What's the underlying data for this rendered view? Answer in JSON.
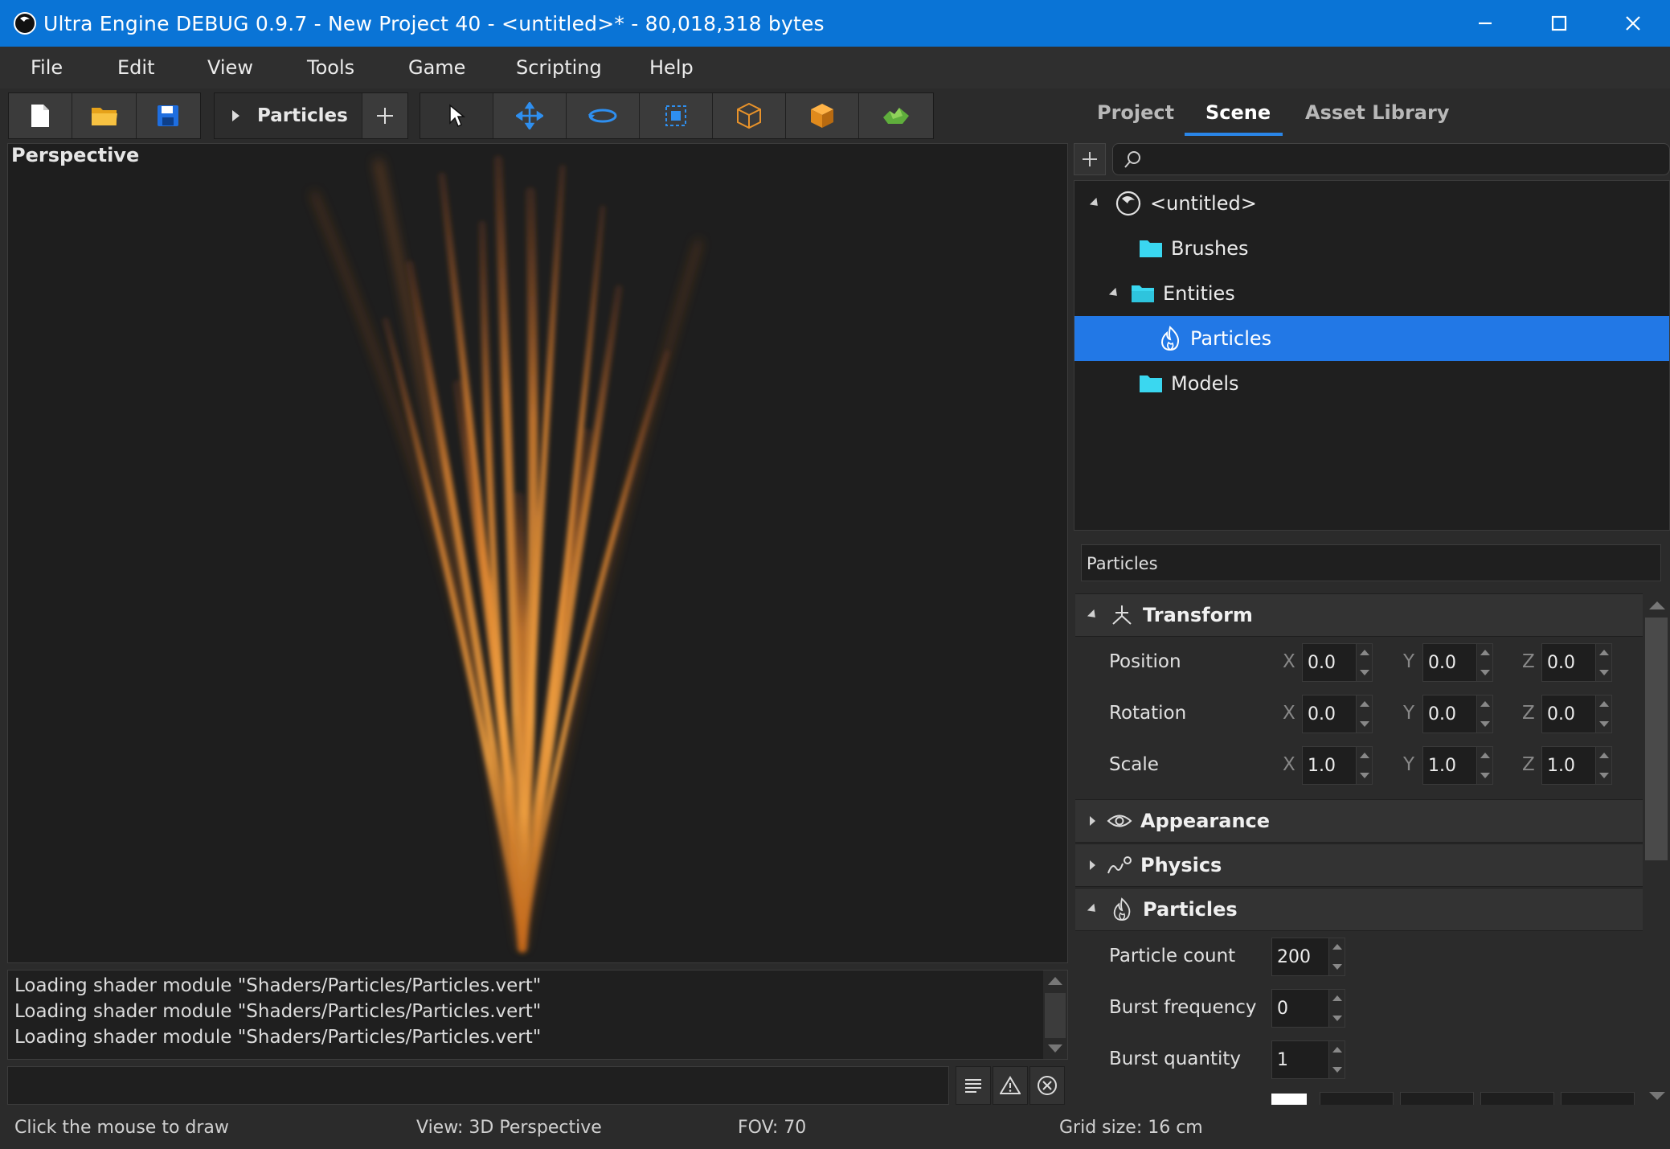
{
  "window": {
    "title": "Ultra Engine DEBUG 0.9.7 - New Project 40 - <untitled>* - 80,018,318 bytes"
  },
  "menu": [
    "File",
    "Edit",
    "View",
    "Tools",
    "Game",
    "Scripting",
    "Help"
  ],
  "toolbar": {
    "file_buttons": [
      "new-file-icon",
      "open-folder-icon",
      "save-icon"
    ],
    "scene_tab_label": "Particles",
    "add_tab_icon": "plus-icon",
    "tools": [
      "select-pointer-icon",
      "move-icon",
      "rotate-icon",
      "scale-icon",
      "wireframe-box-icon",
      "solid-box-icon",
      "terrain-icon"
    ]
  },
  "right_tabs": {
    "items": [
      "Project",
      "Scene",
      "Asset Library"
    ],
    "active": "Scene"
  },
  "viewport": {
    "label": "Perspective"
  },
  "console": {
    "lines": [
      "Loading shader module \"Shaders/Particles/Particles.vert\"",
      "Loading shader module \"Shaders/Particles/Particles.vert\"",
      "Loading shader module \"Shaders/Particles/Particles.vert\""
    ],
    "input_value": ""
  },
  "status": {
    "hint": "Click the mouse to draw",
    "view": "View: 3D Perspective",
    "fov": "FOV: 70",
    "grid": "Grid size: 16 cm"
  },
  "scene": {
    "search_placeholder": "",
    "tree": [
      {
        "label": "<untitled>",
        "icon": "scene-icon",
        "expanded": true,
        "selected": false
      },
      {
        "label": "Brushes",
        "icon": "folder-icon",
        "expanded": false,
        "selected": false
      },
      {
        "label": "Entities",
        "icon": "folder-icon",
        "expanded": true,
        "selected": false
      },
      {
        "label": "Particles",
        "icon": "flame-icon",
        "expanded": false,
        "selected": true
      },
      {
        "label": "Models",
        "icon": "folder-icon",
        "expanded": false,
        "selected": false
      }
    ]
  },
  "properties": {
    "entity_name": "Particles",
    "transform": {
      "title": "Transform",
      "rows": [
        {
          "label": "Position",
          "x": "0.0",
          "y": "0.0",
          "z": "0.0"
        },
        {
          "label": "Rotation",
          "x": "0.0",
          "y": "0.0",
          "z": "0.0"
        },
        {
          "label": "Scale",
          "x": "1.0",
          "y": "1.0",
          "z": "1.0"
        }
      ],
      "axes": [
        "X",
        "Y",
        "Z"
      ]
    },
    "appearance": {
      "title": "Appearance"
    },
    "physics": {
      "title": "Physics"
    },
    "particles": {
      "title": "Particles",
      "rows": [
        {
          "label": "Particle count",
          "value": "200"
        },
        {
          "label": "Burst frequency",
          "value": "0"
        },
        {
          "label": "Burst quantity",
          "value": "1"
        }
      ]
    }
  },
  "colors": {
    "titlebar": "#0a74d6",
    "selection": "#2278e6",
    "folder": "#3ad7f0",
    "accent": "#2a86e8"
  }
}
